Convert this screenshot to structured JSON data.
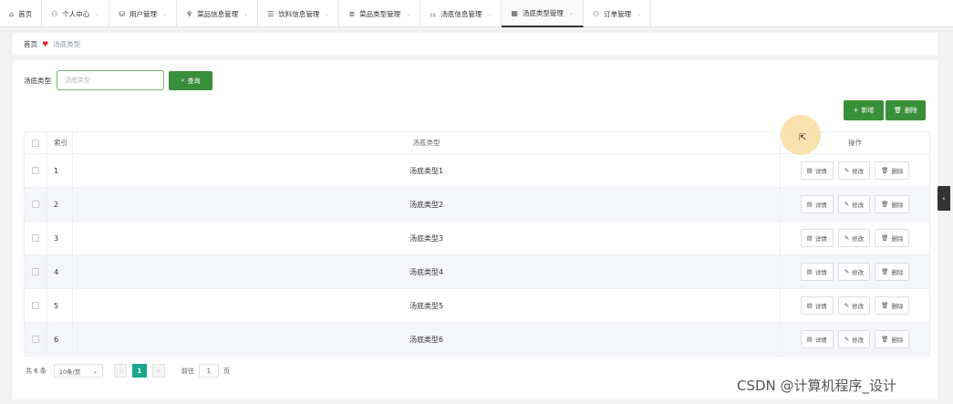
{
  "topnav": {
    "items": [
      {
        "icon": "⌂",
        "label": "首页"
      },
      {
        "icon": "⚇",
        "label": "个人中心"
      },
      {
        "icon": "⛁",
        "label": "用户管理"
      },
      {
        "icon": "♆",
        "label": "菜品信息管理"
      },
      {
        "icon": "☰",
        "label": "饮料信息管理"
      },
      {
        "icon": "≣",
        "label": "菜品类型管理"
      },
      {
        "icon": "⚏",
        "label": "汤底信息管理"
      },
      {
        "icon": "▦",
        "label": "汤底类型管理"
      },
      {
        "icon": "⚇",
        "label": "订单管理"
      }
    ],
    "chevron": "⌄"
  },
  "breadcrumb": {
    "home": "首页",
    "current": "汤底类型"
  },
  "search": {
    "label": "汤底类型",
    "placeholder": "汤底类型",
    "button_label": "查询",
    "button_icon": "⌕"
  },
  "actions": {
    "add_label": "新增",
    "add_icon": "+",
    "delete_label": "删除",
    "delete_icon": "🗑"
  },
  "table": {
    "headers": {
      "index": "索引",
      "name": "汤底类型",
      "ops": "操作"
    },
    "rows": [
      {
        "index": "1",
        "name": "汤底类型1"
      },
      {
        "index": "2",
        "name": "汤底类型2"
      },
      {
        "index": "3",
        "name": "汤底类型3"
      },
      {
        "index": "4",
        "name": "汤底类型4"
      },
      {
        "index": "5",
        "name": "汤底类型5"
      },
      {
        "index": "6",
        "name": "汤底类型6"
      }
    ],
    "op_buttons": {
      "detail": "详情",
      "edit": "修改",
      "delete": "删除",
      "detail_icon": "▤",
      "edit_icon": "✎",
      "delete_icon": "🗑"
    }
  },
  "pagination": {
    "total": "共 6 条",
    "page_size": "10条/页",
    "prev": "‹",
    "next": "›",
    "current_page": "1",
    "goto_label": "前往",
    "goto_value": "1",
    "page_unit": "页"
  },
  "side_tab_icon": "‹",
  "cursor_icon": "⇱",
  "watermark": "CSDN @计算机程序_设计",
  "colors": {
    "primary_green": "#3a8f3a",
    "page_active": "#1aa68a",
    "breadcrumb_heart": "#e0243b"
  }
}
